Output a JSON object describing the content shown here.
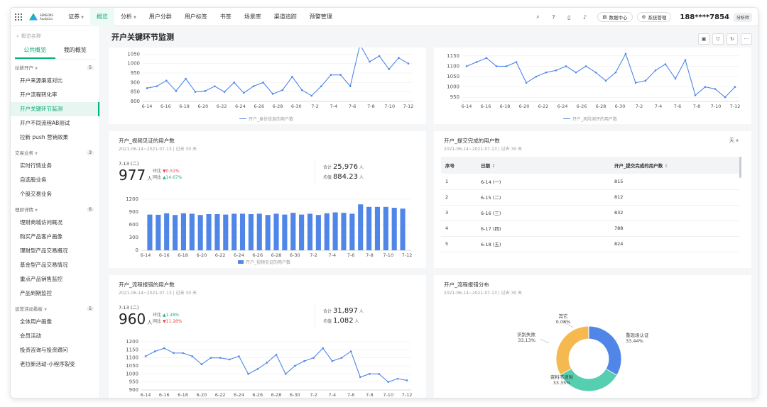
{
  "topbar": {
    "logo_line1": "SENSORS",
    "logo_line2": "Analytics",
    "project": "证券",
    "nav": [
      "概览",
      "分析",
      "用户分群",
      "用户标签",
      "书签",
      "场景库",
      "渠道追踪",
      "预警管理"
    ],
    "data_center": "数据中心",
    "system_mgmt": "系统管理",
    "phone": "188****7854",
    "role": "分析师"
  },
  "sidebar": {
    "search_placeholder": "概览名称",
    "tabs": [
      "公共概览",
      "我的概览"
    ],
    "groups": [
      {
        "name": "拉新开户",
        "count": "5",
        "items": [
          "开户来源渠道对比",
          "开户流程转化率",
          "开户关键环节监测",
          "开户不同流程AB测试",
          "拉新 push 营销效果"
        ]
      },
      {
        "name": "交易业务",
        "count": "3",
        "items": [
          "实时行情业务",
          "自选股业务",
          "个股交易业务"
        ]
      },
      {
        "name": "理财详情",
        "count": "6",
        "items": [
          "理财商城访问概况",
          "购买产品客户画像",
          "理财型产品交易概况",
          "基金型产品交易情况",
          "重点产品销售监控",
          "产品到期监控"
        ]
      },
      {
        "name": "运营活动看板",
        "count": "5",
        "items": [
          "全体用户画像",
          "会员活动",
          "投资咨询与投资跟问",
          "老拉新活动-小程序裂变"
        ]
      }
    ],
    "active_item": "开户关键环节监测"
  },
  "page": {
    "title": "开户关键环节监测"
  },
  "cards": {
    "top_left": {
      "legend": "开户_身份信息的用户数"
    },
    "top_right": {
      "legend": "开户_风险测评的用户数"
    },
    "video": {
      "title": "开户_视频见证的用户数",
      "range": "2021-06-14~2021-07-13 | 过去 30 天",
      "kpi_date": "7-13 (二)",
      "kpi_value": "977",
      "kpi_unit": "人",
      "mom_label": "环比",
      "mom_value": "▼0.51%",
      "yoy_label": "同比",
      "yoy_value": "▲14.67%",
      "total_label": "合计",
      "total_value": "25,976",
      "avg_label": "均值",
      "avg_value": "884.23",
      "legend": "开户_视频见证的用户数"
    },
    "submit": {
      "title": "开户_提交完成的用户数",
      "range": "2021-06-14~2021-07-13 | 过去 30 天",
      "granularity": "天",
      "columns": [
        "序号",
        "日期",
        "开户_提交完成的用户数"
      ],
      "rows": [
        [
          "1",
          "6-14 (一)",
          "815"
        ],
        [
          "2",
          "6-15 (二)",
          "812"
        ],
        [
          "3",
          "6-16 (三)",
          "832"
        ],
        [
          "4",
          "6-17 (四)",
          "788"
        ],
        [
          "5",
          "6-18 (五)",
          "824"
        ]
      ]
    },
    "error": {
      "title": "开户_流程报错的用户数",
      "range": "2021-06-14~2021-07-13 | 过去 30 天",
      "kpi_date": "7-13 (二)",
      "kpi_value": "960",
      "kpi_unit": "人",
      "mom_label": "环比",
      "mom_value": "▲1.48%",
      "yoy_label": "同比",
      "yoy_value": "▼11.28%",
      "total_label": "合计",
      "total_value": "31,897",
      "avg_label": "均值",
      "avg_value": "1,082"
    },
    "dist": {
      "title": "开户_流程报错分布",
      "range": "2021-06-14~2021-07-13 | 过去 30 天"
    }
  },
  "chart_data": [
    {
      "type": "line",
      "series": [
        {
          "name": "开户_身份信息的用户数",
          "values": [
            870,
            880,
            910,
            855,
            920,
            850,
            855,
            880,
            850,
            900,
            845,
            880,
            900,
            840,
            860,
            930,
            860,
            830,
            880,
            940,
            940,
            880,
            1100,
            1010,
            1040,
            970,
            1030,
            1000
          ]
        }
      ],
      "x_tick_labels": [
        "6-14",
        "6-16",
        "6-18",
        "6-20",
        "6-22",
        "6-24",
        "6-26",
        "6-28",
        "6-30",
        "7-2",
        "7-4",
        "7-6",
        "7-8",
        "7-10",
        "7-12"
      ],
      "y_ticks": [
        800,
        850,
        900,
        950,
        1000,
        1050
      ],
      "ylim": [
        800,
        1070
      ]
    },
    {
      "type": "line",
      "series": [
        {
          "name": "开户_风险测评的用户数",
          "values": [
            1100,
            1120,
            1140,
            1100,
            1100,
            1120,
            1020,
            1050,
            1070,
            1080,
            1100,
            1070,
            1100,
            1070,
            1030,
            1070,
            1160,
            1020,
            1030,
            1080,
            1110,
            1040,
            1130,
            960,
            1000,
            990,
            950,
            1000
          ]
        }
      ],
      "x_tick_labels": [
        "6-14",
        "6-16",
        "6-18",
        "6-20",
        "6-22",
        "6-24",
        "6-26",
        "6-28",
        "6-30",
        "7-2",
        "7-4",
        "7-6",
        "7-8",
        "7-10",
        "7-12"
      ],
      "y_ticks": [
        950,
        1000,
        1050,
        1100,
        1150
      ],
      "ylim": [
        930,
        1170
      ]
    },
    {
      "type": "bar",
      "series": [
        {
          "name": "开户_视频见证的用户数",
          "values": [
            840,
            835,
            870,
            830,
            870,
            860,
            830,
            850,
            850,
            840,
            860,
            860,
            850,
            860,
            830,
            860,
            840,
            880,
            840,
            860,
            830,
            870,
            890,
            880,
            860,
            1080,
            1020,
            1020,
            1020,
            1000,
            980
          ]
        }
      ],
      "x_tick_labels": [
        "6-14",
        "6-16",
        "6-18",
        "6-20",
        "6-22",
        "6-24",
        "6-26",
        "6-28",
        "6-30",
        "7-2",
        "7-4",
        "7-6",
        "7-8",
        "7-10",
        "7-12"
      ],
      "y_ticks": [
        0,
        300,
        600,
        900,
        1200
      ],
      "ylim": [
        0,
        1200
      ]
    },
    {
      "type": "line",
      "series": [
        {
          "name": "开户_流程报错的用户数",
          "values": [
            1110,
            1140,
            1160,
            1130,
            1130,
            1110,
            1060,
            1100,
            1100,
            1090,
            1110,
            1000,
            1030,
            1070,
            1120,
            1000,
            1050,
            1080,
            1100,
            1160,
            1080,
            1100,
            1140,
            980,
            1000,
            1000,
            950,
            970,
            960
          ]
        }
      ],
      "x_tick_labels": [
        "6-14",
        "6-16",
        "6-18",
        "6-20",
        "6-22",
        "6-24",
        "6-26",
        "6-28",
        "6-30",
        "7-2",
        "7-4",
        "7-6",
        "7-8",
        "7-10",
        "7-12"
      ],
      "y_ticks": [
        900,
        950,
        1000,
        1050,
        1100,
        1150,
        1200
      ],
      "ylim": [
        900,
        1200
      ]
    },
    {
      "type": "pie",
      "slices": [
        {
          "label": "重现场认证",
          "pct": "33.44%",
          "value": 33.44,
          "color": "#4f86e8"
        },
        {
          "label": "资料不清晰",
          "pct": "33.35%",
          "value": 33.35,
          "color": "#55cfb0"
        },
        {
          "label": "识别失败",
          "pct": "33.13%",
          "value": 33.13,
          "color": "#f5b950"
        },
        {
          "label": "其它",
          "pct": "0.08%",
          "value": 0.08,
          "color": "#9ca3af"
        }
      ]
    }
  ]
}
